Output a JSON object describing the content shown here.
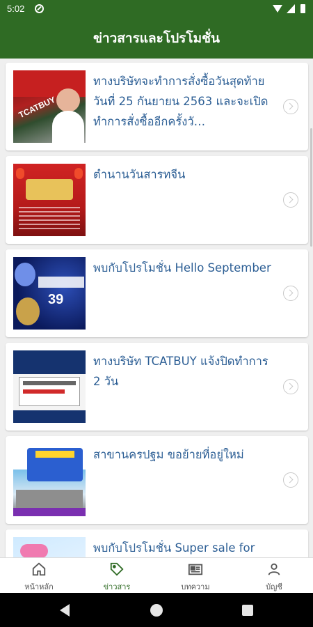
{
  "status_bar": {
    "time": "5:02"
  },
  "app_bar": {
    "title": "ข่าวสารและโปรโมชั่น"
  },
  "news": [
    {
      "title": "ทางบริษัทจะทำการสั่งซื้อวันสุดท้ายวันที่ 25 กันยายน 2563 และจะเปิดทำการสั่งซื้ออีกครั้งวั…",
      "thumb_text": "TCATBUY"
    },
    {
      "title": "ตำนานวันสารทจีน"
    },
    {
      "title": "พบกับโปรโมชั่น Hello September",
      "thumb_text": "39"
    },
    {
      "title": "ทางบริษัท TCATBUY แจ้งปิดทำการ 2 วัน"
    },
    {
      "title": "สาขานครปฐม ขอย้ายที่อยู่ใหม่"
    },
    {
      "title": "พบกับโปรโมชั่น Super sale for"
    }
  ],
  "bottom_nav": {
    "items": [
      {
        "label": "หน้าหลัก",
        "icon": "home-icon"
      },
      {
        "label": "ข่าวสาร",
        "icon": "tag-icon"
      },
      {
        "label": "บทความ",
        "icon": "newspaper-icon"
      },
      {
        "label": "บัญชี",
        "icon": "person-icon"
      }
    ],
    "active_index": 1
  },
  "colors": {
    "primary": "#2f6b24",
    "title_text": "#2d5f95",
    "background": "#efefef"
  }
}
